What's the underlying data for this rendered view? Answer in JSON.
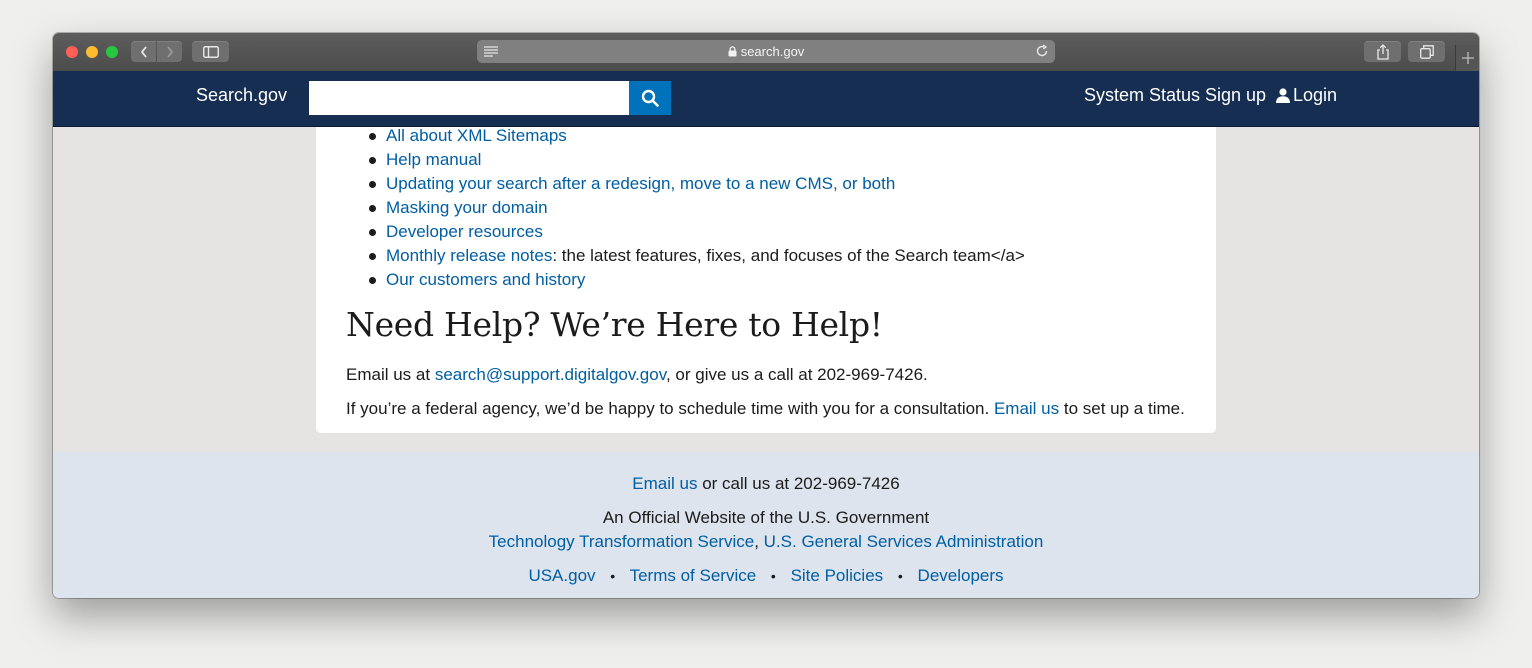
{
  "browser": {
    "url": "search.gov"
  },
  "header": {
    "brand": "Search.gov",
    "search_placeholder": "",
    "nav": {
      "status": "System Status",
      "signup": "Sign up",
      "login": "Login"
    }
  },
  "content": {
    "list_items": [
      {
        "link": "All about XML Sitemaps",
        "suffix": ""
      },
      {
        "link": "Help manual",
        "suffix": ""
      },
      {
        "link": "Updating your search after a redesign, move to a new CMS, or both",
        "suffix": ""
      },
      {
        "link": "Masking your domain",
        "suffix": ""
      },
      {
        "link": "Developer resources",
        "suffix": ""
      },
      {
        "link": "Monthly release notes",
        "suffix": ": the latest features, fixes, and focuses of the Search team</a>"
      },
      {
        "link": "Our customers and history",
        "suffix": ""
      }
    ],
    "help_heading": "Need Help? We’re Here to Help!",
    "email_prefix": "Email us at ",
    "email_link": "search@support.digitalgov.gov",
    "email_suffix": ", or give us a call at 202-969-7426.",
    "agency_prefix": "If you’re a federal agency, we’d be happy to schedule time with you for a consultation. ",
    "agency_link": "Email us",
    "agency_suffix": " to set up a time."
  },
  "footer": {
    "email_link": "Email us",
    "call_text": " or call us at 202-969-7426",
    "official_text": "An Official Website of the U.S. Government",
    "tts_link": "Technology Transformation Service",
    "comma": ",",
    "gsa_link": "U.S. General Services Administration",
    "bottom_links": [
      "USA.gov",
      "Terms of Service",
      "Site Policies",
      "Developers"
    ],
    "separator": "•"
  },
  "colors": {
    "header_bg": "#162e51",
    "link": "#005ea2",
    "search_button": "#0071bb",
    "footer_bg": "#dde4ee"
  }
}
